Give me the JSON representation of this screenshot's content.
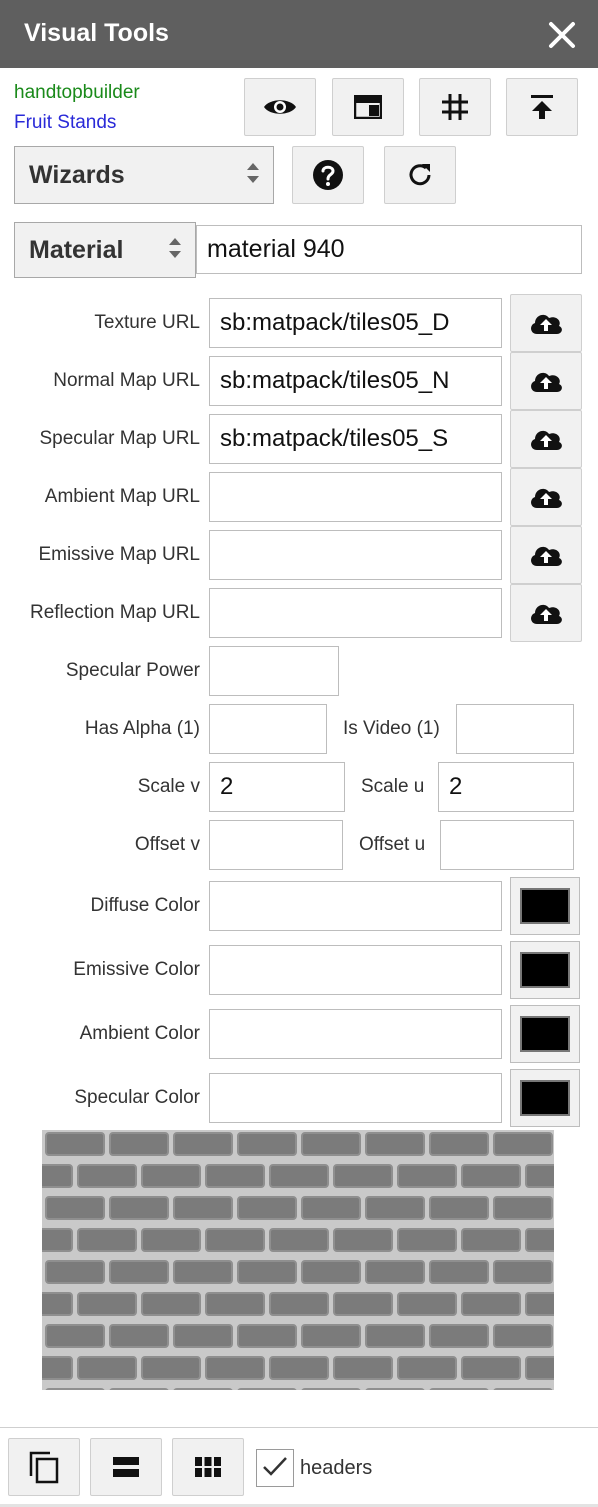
{
  "window": {
    "title": "Visual Tools"
  },
  "header": {
    "user": "handtopbuilder",
    "project": "Fruit Stands"
  },
  "toolbar": {
    "icons": [
      "eye-icon",
      "panel-icon",
      "grid-icon",
      "upload-top-icon"
    ]
  },
  "wizards": {
    "selected": "Wizards"
  },
  "material": {
    "type_selected": "Material",
    "name": "material 940"
  },
  "fields": {
    "texture_url": {
      "label": "Texture URL",
      "value": "sb:matpack/tiles05_D"
    },
    "normal_map_url": {
      "label": "Normal Map URL",
      "value": "sb:matpack/tiles05_N"
    },
    "specular_map_url": {
      "label": "Specular Map URL",
      "value": "sb:matpack/tiles05_S"
    },
    "ambient_map_url": {
      "label": "Ambient Map URL",
      "value": ""
    },
    "emissive_map_url": {
      "label": "Emissive Map URL",
      "value": ""
    },
    "reflection_map_url": {
      "label": "Reflection Map URL",
      "value": ""
    },
    "specular_power": {
      "label": "Specular Power",
      "value": ""
    },
    "has_alpha": {
      "label": "Has Alpha (1)",
      "value": ""
    },
    "is_video": {
      "label": "Is Video (1)",
      "value": ""
    },
    "scale_v": {
      "label": "Scale v",
      "value": "2"
    },
    "scale_u": {
      "label": "Scale u",
      "value": "2"
    },
    "offset_v": {
      "label": "Offset v",
      "value": ""
    },
    "offset_u": {
      "label": "Offset u",
      "value": ""
    },
    "diffuse_color": {
      "label": "Diffuse Color",
      "value": "",
      "swatch": "#000000"
    },
    "emissive_color": {
      "label": "Emissive Color",
      "value": "",
      "swatch": "#000000"
    },
    "ambient_color": {
      "label": "Ambient Color",
      "value": "",
      "swatch": "#000000"
    },
    "specular_color": {
      "label": "Specular Color",
      "value": "",
      "swatch": "#000000"
    }
  },
  "footer": {
    "headers_label": "headers",
    "headers_checked": true
  },
  "colors": {
    "titlebar": "#5f5f5f",
    "user": "#1a8a1a",
    "project": "#2a2ad8"
  }
}
